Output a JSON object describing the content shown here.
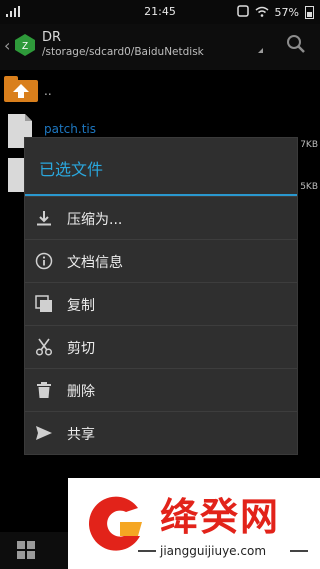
{
  "status_bar": {
    "time": "21:45",
    "battery": "57%"
  },
  "app_bar": {
    "title": "DR",
    "path": "/storage/sdcard0/BaiduNetdisk"
  },
  "file_list": {
    "parent_label": "..",
    "items": [
      {
        "name": "patch.tis",
        "size": "7KB"
      },
      {
        "name": "",
        "size": "5KB"
      }
    ]
  },
  "dialog": {
    "title": "已选文件",
    "items": [
      {
        "label": "压缩为...",
        "icon": "download-icon"
      },
      {
        "label": "文档信息",
        "icon": "info-icon"
      },
      {
        "label": "复制",
        "icon": "copy-icon"
      },
      {
        "label": "剪切",
        "icon": "scissors-icon"
      },
      {
        "label": "删除",
        "icon": "trash-icon"
      },
      {
        "label": "共享",
        "icon": "send-icon"
      }
    ]
  },
  "ad_banner": {
    "name": "绛癸网",
    "url": "jiangguijiuye.com"
  },
  "colors": {
    "accent": "#2aa7dd",
    "link": "#1e78c2",
    "ad_red": "#e2231a"
  }
}
